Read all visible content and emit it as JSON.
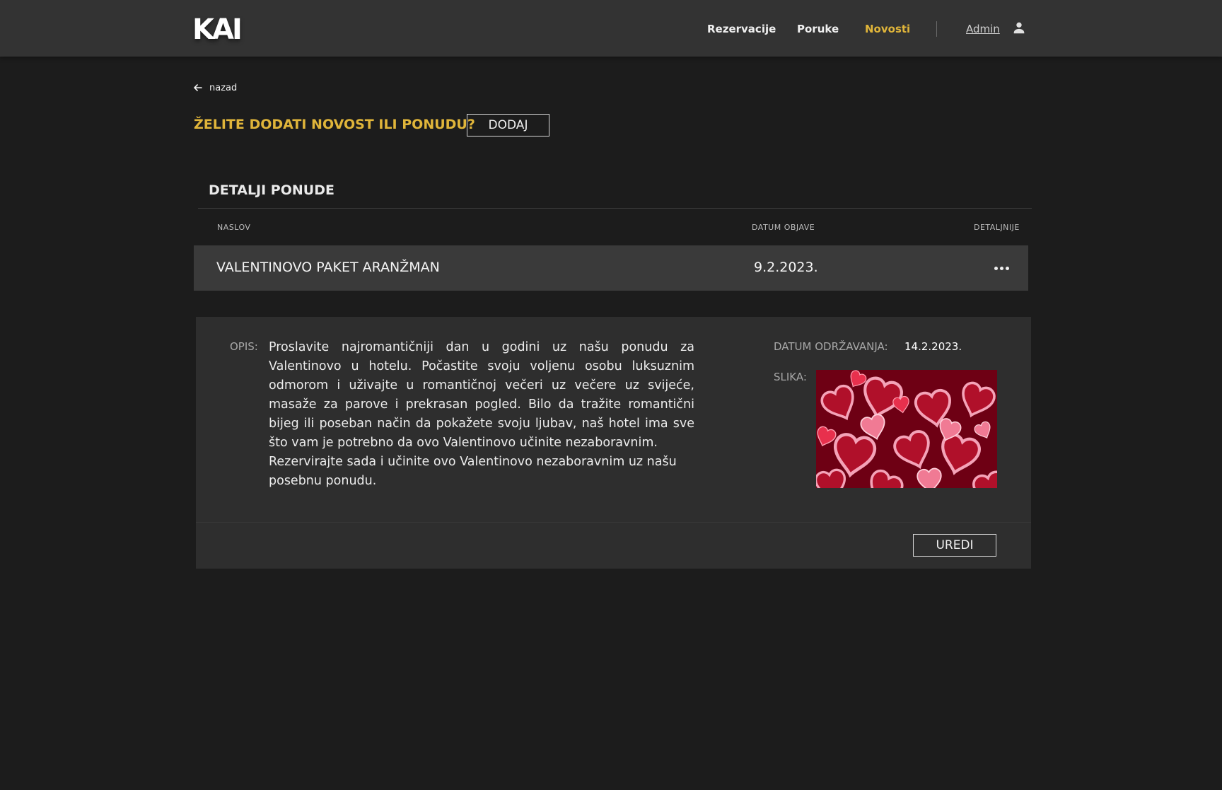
{
  "header": {
    "logo": "KAI",
    "nav": [
      {
        "label": "Rezervacije"
      },
      {
        "label": "Poruke"
      },
      {
        "label": "Novosti",
        "active": true
      }
    ],
    "user_label": "Admin",
    "user_icon": "person-icon"
  },
  "colors": {
    "accent": "#e0b53a",
    "background": "#1c1c1c",
    "header_bg": "#333333",
    "row_bg": "#3a3a3a",
    "panel_bg": "#2e2e2e"
  },
  "back_link": {
    "label": "nazad",
    "icon": "arrow-left-icon"
  },
  "cta": {
    "title": "ŽELITE DODATI NOVOST ILI PONUDU?",
    "button": "DODAJ"
  },
  "section": {
    "title": "DETALJI PONUDE",
    "columns": [
      "NASLOV",
      "DATUM OBJAVE",
      "DETALJNIJE"
    ],
    "row": {
      "title": "VALENTINOVO PAKET ARANŽMAN",
      "date": "9.2.2023.",
      "more_icon": "ellipsis-icon"
    }
  },
  "detail": {
    "opis_label": "OPIS:",
    "opis_text": "Proslavite najromantičniji dan u godini uz našu ponudu za Valentinovo u hotelu. Počastite svoju voljenu osobu luksuznim odmorom i uživajte u romantičnoj večeri uz večere uz svijeće, masaže za parove i prekrasan pogled. Bilo da tražite romantični bijeg ili poseban način da pokažete svoju ljubav, naš hotel ima sve što vam je potrebno da ovo Valentinovo učinite nezaboravnim.",
    "opis_text_2": "Rezervirajte sada i učinite ovo Valentinovo nezaboravnim uz našu posebnu ponudu.",
    "datum_label": "DATUM ODRŽAVANJA:",
    "datum_value": "14.2.2023.",
    "slika_label": "SLIKA:",
    "edit_button": "UREDI"
  }
}
